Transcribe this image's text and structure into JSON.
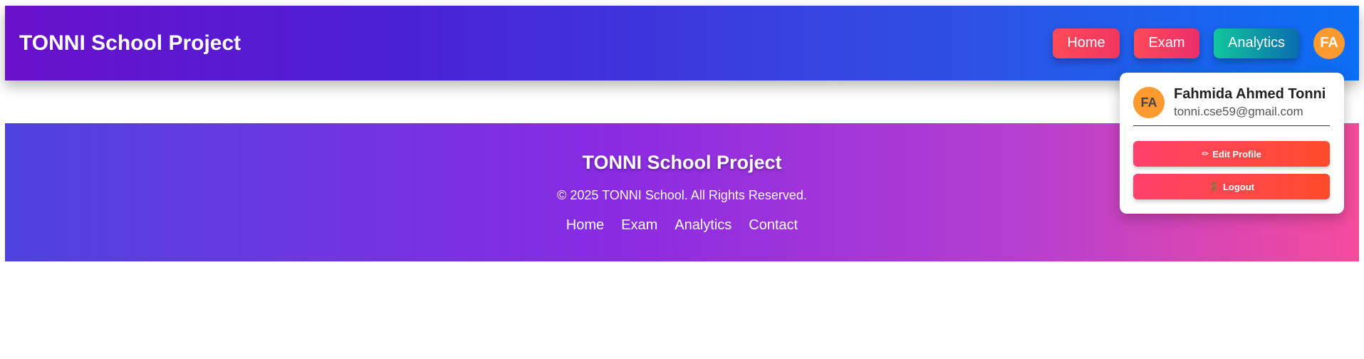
{
  "header": {
    "brand": "TONNI School Project",
    "nav": [
      {
        "label": "Home"
      },
      {
        "label": "Exam"
      },
      {
        "label": "Analytics"
      }
    ],
    "avatar_initials": "FA"
  },
  "profile_menu": {
    "avatar_initials": "FA",
    "name": "Fahmida Ahmed Tonni",
    "email": "tonni.cse59@gmail.com",
    "edit_icon": "pencil-icon",
    "edit_label": "Edit Profile",
    "logout_icon": "door-icon",
    "logout_label": "Logout"
  },
  "footer": {
    "title": "TONNI School Project",
    "copyright": "© 2025 TONNI School. All Rights Reserved.",
    "links": [
      {
        "label": "Home"
      },
      {
        "label": "Exam"
      },
      {
        "label": "Analytics"
      },
      {
        "label": "Contact"
      }
    ]
  },
  "colors": {
    "header_gradient_start": "#6a11cb",
    "header_gradient_end": "#0c6ff5",
    "footer_gradient_start": "#4e42e0",
    "footer_gradient_end": "#f54b9c",
    "avatar": "#ff9a2e",
    "accent_red": "#ff416c",
    "accent_teal": "#10c79c"
  }
}
